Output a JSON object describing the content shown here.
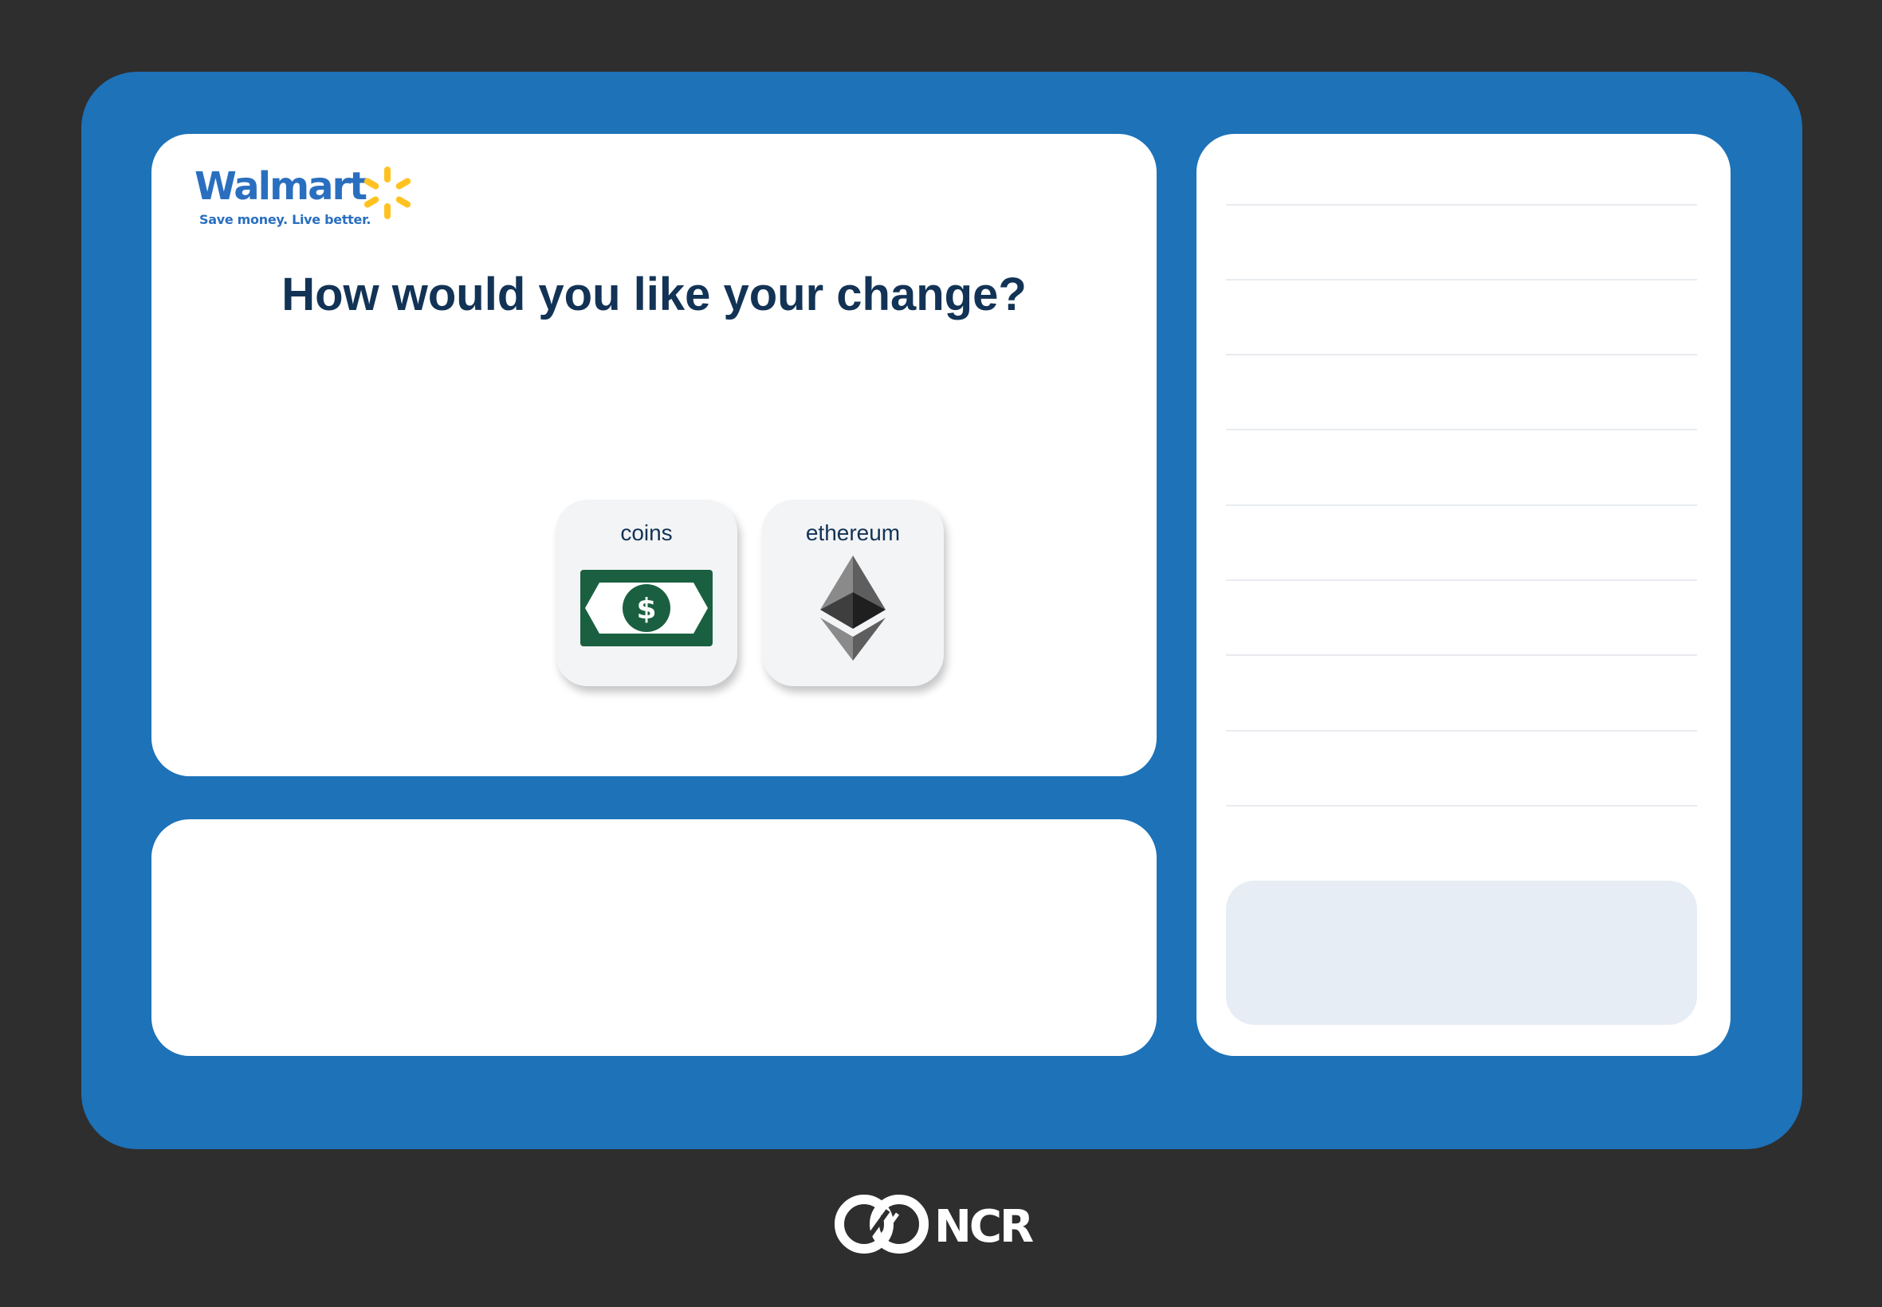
{
  "brand": {
    "name": "Walmart",
    "tagline": "Save money. Live better.",
    "color": "#2a6fbf",
    "spark_color": "#ffc220"
  },
  "prompt": {
    "question": "How would you like your change?"
  },
  "options": [
    {
      "label": "coins",
      "icon": "cash-bill-icon"
    },
    {
      "label": "ethereum",
      "icon": "ethereum-icon"
    }
  ],
  "footer": {
    "brand": "NCR"
  },
  "colors": {
    "background": "#2e2e2e",
    "frame": "#1d72b8",
    "text": "#123355",
    "cash_green": "#1a6040"
  }
}
